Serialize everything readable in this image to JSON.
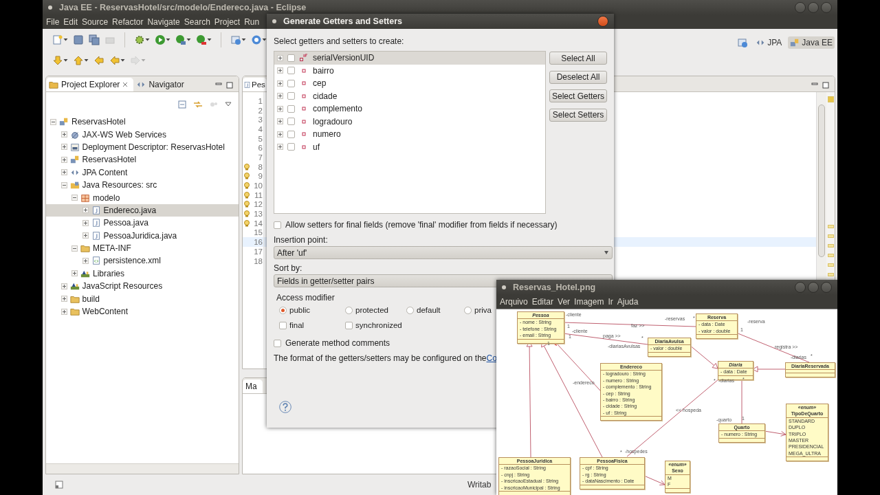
{
  "window": {
    "title": "Java EE - ReservasHotel/src/modelo/Endereco.java - Eclipse"
  },
  "menu": [
    "File",
    "Edit",
    "Source",
    "Refactor",
    "Navigate",
    "Search",
    "Project",
    "Run"
  ],
  "perspectives": [
    {
      "label": "JPA",
      "selected": false
    },
    {
      "label": "Java EE",
      "selected": true
    }
  ],
  "explorer": {
    "tabs": [
      {
        "label": "Project Explorer",
        "selected": true
      },
      {
        "label": "Navigator",
        "selected": false
      }
    ],
    "tree": [
      {
        "label": "ReservasHotel",
        "kind": "project",
        "expanded": true,
        "selected": false,
        "children": [
          {
            "label": "JAX-WS Web Services",
            "kind": "service",
            "expanded": false,
            "selected": false
          },
          {
            "label": "Deployment Descriptor: ReservasHotel",
            "kind": "descriptor",
            "expanded": false,
            "selected": false
          },
          {
            "label": "ReservasHotel",
            "kind": "project",
            "expanded": false,
            "selected": false
          },
          {
            "label": "JPA Content",
            "kind": "jpa",
            "expanded": false,
            "selected": false
          },
          {
            "label": "Java Resources: src",
            "kind": "resources",
            "expanded": true,
            "selected": false,
            "children": [
              {
                "label": "modelo",
                "kind": "package",
                "expanded": true,
                "selected": false,
                "children": [
                  {
                    "label": "Endereco.java",
                    "kind": "java",
                    "expanded": false,
                    "selected": true
                  },
                  {
                    "label": "Pessoa.java",
                    "kind": "java",
                    "expanded": false,
                    "selected": false
                  },
                  {
                    "label": "PessoaJuridica.java",
                    "kind": "java",
                    "expanded": false,
                    "selected": false
                  }
                ]
              },
              {
                "label": "META-INF",
                "kind": "folder",
                "expanded": true,
                "selected": false,
                "children": [
                  {
                    "label": "persistence.xml",
                    "kind": "xml",
                    "expanded": false,
                    "selected": false
                  }
                ]
              },
              {
                "label": "Libraries",
                "kind": "library",
                "expanded": false,
                "selected": false
              }
            ]
          },
          {
            "label": "JavaScript Resources",
            "kind": "library",
            "expanded": false,
            "selected": false
          },
          {
            "label": "build",
            "kind": "folder",
            "expanded": false,
            "selected": false
          },
          {
            "label": "WebContent",
            "kind": "folder",
            "expanded": false,
            "selected": false
          }
        ]
      }
    ]
  },
  "editor": {
    "tab": "Pes",
    "lines": [
      {
        "n": "1",
        "warning": false,
        "current": false
      },
      {
        "n": "2",
        "warning": false,
        "current": false
      },
      {
        "n": "3",
        "warning": false,
        "current": false
      },
      {
        "n": "4",
        "warning": false,
        "current": false
      },
      {
        "n": "5",
        "warning": false,
        "current": false
      },
      {
        "n": "6",
        "warning": false,
        "current": false
      },
      {
        "n": "7",
        "warning": false,
        "current": false
      },
      {
        "n": "8",
        "warning": true,
        "current": false
      },
      {
        "n": "9",
        "warning": true,
        "current": false
      },
      {
        "n": "10",
        "warning": true,
        "current": false
      },
      {
        "n": "11",
        "warning": true,
        "current": false
      },
      {
        "n": "12",
        "warning": true,
        "current": false
      },
      {
        "n": "13",
        "warning": true,
        "current": false
      },
      {
        "n": "14",
        "warning": true,
        "current": false
      },
      {
        "n": "15",
        "warning": false,
        "current": false
      },
      {
        "n": "16",
        "warning": false,
        "current": true
      },
      {
        "n": "17",
        "warning": false,
        "current": false
      },
      {
        "n": "18",
        "warning": false,
        "current": false
      }
    ]
  },
  "bottom_panel": {
    "tab": "Ma"
  },
  "status_bar": {
    "text": "Writab"
  },
  "dialog": {
    "title": "Generate Getters and Setters",
    "prompt": "Select getters and setters to create:",
    "fields": [
      {
        "name": "serialVersionUID",
        "kind": "constant",
        "checked": false,
        "expanded": false,
        "selected": true
      },
      {
        "name": "bairro",
        "kind": "field",
        "checked": false,
        "expanded": false,
        "selected": false
      },
      {
        "name": "cep",
        "kind": "field",
        "checked": false,
        "expanded": false,
        "selected": false
      },
      {
        "name": "cidade",
        "kind": "field",
        "checked": false,
        "expanded": false,
        "selected": false
      },
      {
        "name": "complemento",
        "kind": "field",
        "checked": false,
        "expanded": false,
        "selected": false
      },
      {
        "name": "logradouro",
        "kind": "field",
        "checked": false,
        "expanded": false,
        "selected": false
      },
      {
        "name": "numero",
        "kind": "field",
        "checked": false,
        "expanded": false,
        "selected": false
      },
      {
        "name": "uf",
        "kind": "field",
        "checked": false,
        "expanded": false,
        "selected": false
      }
    ],
    "buttons": [
      "Select All",
      "Deselect All",
      "Select Getters",
      "Select Setters"
    ],
    "allow_final": {
      "label": "Allow setters for final fields (remove 'final' modifier from fields if necessary)",
      "checked": false
    },
    "insertion_point": {
      "label": "Insertion point:",
      "value": "After 'uf'"
    },
    "sort_by": {
      "label": "Sort by:",
      "value": "Fields in getter/setter pairs"
    },
    "access_modifier": {
      "label": "Access modifier",
      "radios": [
        {
          "label": "public",
          "selected": true
        },
        {
          "label": "protected",
          "selected": false
        },
        {
          "label": "default",
          "selected": false
        },
        {
          "label": "priva",
          "selected": false
        }
      ],
      "checkboxes": [
        {
          "label": "final",
          "checked": false
        },
        {
          "label": "synchronized",
          "checked": false
        }
      ]
    },
    "generate_comments": {
      "label": "Generate method comments",
      "checked": false
    },
    "note": {
      "text": "The format of the getters/setters may be configured on the ",
      "link": "Co"
    }
  },
  "image_viewer": {
    "title": "Reservas_Hotel.png",
    "menu": [
      "Arquivo",
      "Editar",
      "Ver",
      "Imagem",
      "Ir",
      "Ajuda"
    ],
    "classes": [
      {
        "name": "Pessoa",
        "abstract": true,
        "attributes": [
          "- nome : String",
          "- telefone : String",
          "- email : String"
        ]
      },
      {
        "name": "Reserva",
        "abstract": false,
        "attributes": [
          "- data : Date",
          "- valor : double"
        ]
      },
      {
        "name": "DiariaAvulsa",
        "abstract": false,
        "attributes": [
          "- valor : double"
        ]
      },
      {
        "name": "Endereco",
        "abstract": false,
        "attributes": [
          "- logradouro : String",
          "- numero : String",
          "- complemento : String",
          "- cep : String",
          "- bairro : String",
          "- cidade : String",
          "- uf : String"
        ]
      },
      {
        "name": "Diaria",
        "abstract": true,
        "attributes": [
          "- data : Date"
        ]
      },
      {
        "name": "DiariaReservada",
        "abstract": false
      },
      {
        "name": "Quarto",
        "abstract": false,
        "attributes": [
          "- numero : String"
        ]
      },
      {
        "name": "TipoDeQuarto",
        "stereotype": "«enum»",
        "abstract": false,
        "attributes": [
          "STANDARD",
          "DUPLO",
          "TRIPLO",
          "MASTER",
          "PRESIDENCIAL",
          "MEGA_ULTRA"
        ]
      },
      {
        "name": "PessoaJuridica",
        "abstract": false,
        "attributes": [
          "- razaoSocial : String",
          "- cnpj : String",
          "- inscricaoEstadual : String",
          "- inscricaoMunicipal : String"
        ]
      },
      {
        "name": "PessoaFisica",
        "abstract": false,
        "attributes": [
          "- cpf : String",
          "- rg : String",
          "- dataNascimento : Date"
        ]
      },
      {
        "name": "Sexo",
        "stereotype": "«enum»",
        "abstract": false,
        "attributes": [
          "M",
          "F"
        ]
      }
    ],
    "labels": [
      "-cliente",
      "1",
      "faz >>",
      "-reservas",
      "*",
      "-reserva",
      "1",
      "-cliente",
      "1",
      "paga >>",
      "*",
      "-diariasAvulsas",
      "registra >>",
      "-diarias",
      "*",
      "1",
      "-endereco",
      "*",
      "-diarias",
      "*",
      "<< hospeda",
      "-quarto",
      "1",
      "*",
      "-hospedes"
    ]
  }
}
